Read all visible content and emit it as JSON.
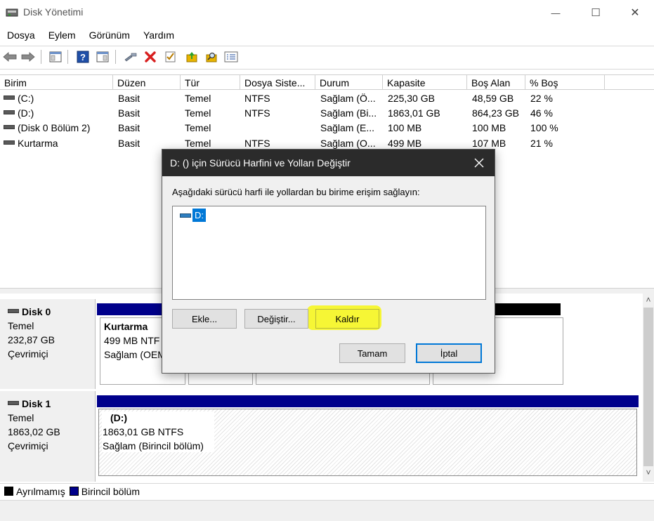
{
  "window": {
    "title": "Disk Yönetimi",
    "controls": {
      "minimize": "—",
      "maximize": "☐",
      "close": "✕"
    }
  },
  "menu": [
    "Dosya",
    "Eylem",
    "Görünüm",
    "Yardım"
  ],
  "toolbar": {
    "icons": [
      "back-arrow-icon",
      "forward-arrow-icon",
      "console-tree-icon",
      "help-icon",
      "properties-icon",
      "connect-icon",
      "delete-icon",
      "check-icon",
      "folder-up-icon",
      "search-folder-icon",
      "list-icon"
    ],
    "colors": {
      "delete": "#d81f1f",
      "help": "#1f4fa8",
      "folder": "#e8b400"
    }
  },
  "volumes": {
    "columns": [
      "Birim",
      "Düzen",
      "Tür",
      "Dosya Siste...",
      "Durum",
      "Kapasite",
      "Boş Alan",
      "% Boş"
    ],
    "rows": [
      [
        "(C:)",
        "Basit",
        "Temel",
        "NTFS",
        "Sağlam (Ö...",
        "225,30 GB",
        "48,59 GB",
        "22 %"
      ],
      [
        "(D:)",
        "Basit",
        "Temel",
        "NTFS",
        "Sağlam (Bi...",
        "1863,01 GB",
        "864,23 GB",
        "46 %"
      ],
      [
        "(Disk 0 Bölüm 2)",
        "Basit",
        "Temel",
        "",
        "Sağlam (E...",
        "100 MB",
        "100 MB",
        "100 %"
      ],
      [
        "Kurtarma",
        "Basit",
        "Temel",
        "NTFS",
        "Sağlam (O...",
        "499 MB",
        "107 MB",
        "21 %"
      ]
    ]
  },
  "disks": [
    {
      "name": "Disk 0",
      "type": "Temel",
      "size": "232,87 GB",
      "status": "Çevrimiçi",
      "partition": {
        "name": "Kurtarma",
        "line1": "499 MB NTF",
        "line2": "Sağlam (OEM"
      }
    },
    {
      "name": "Disk 1",
      "type": "Temel",
      "size": "1863,02 GB",
      "status": "Çevrimiçi",
      "partition": {
        "name": "(D:)",
        "line1": "1863,01 GB NTFS",
        "line2": "Sağlam (Birincil bölüm)"
      }
    }
  ],
  "legend": {
    "items": [
      {
        "label": "Ayrılmamış",
        "color": "#000000"
      },
      {
        "label": "Birincil bölüm",
        "color": "#00008b"
      }
    ]
  },
  "dialog": {
    "title": "D: () için Sürücü Harfini ve Yolları Değiştir",
    "close": "✕",
    "prompt": "Aşağıdaki sürücü harfi ile yollardan bu birime erişim sağlayın:",
    "entries": [
      "D:"
    ],
    "buttons": {
      "add": "Ekle...",
      "change": "Değiştir...",
      "remove": "Kaldır",
      "ok": "Tamam",
      "cancel": "İptal"
    },
    "highlight_color": "#f6f62a"
  },
  "scroll": {
    "up": "˄",
    "down": "˅"
  }
}
